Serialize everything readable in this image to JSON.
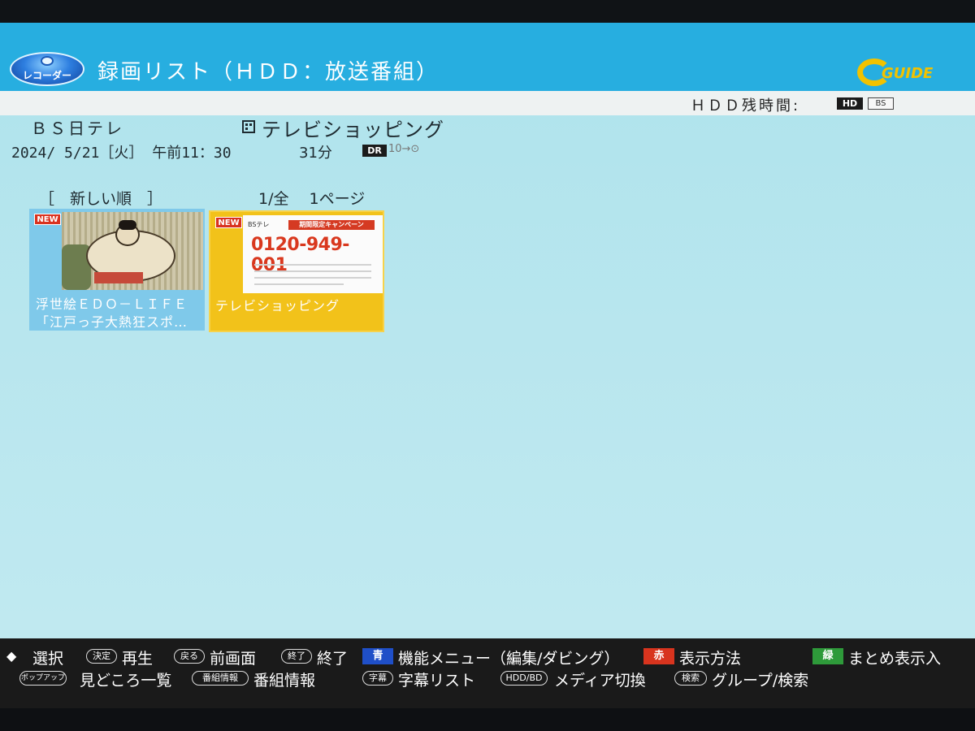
{
  "header": {
    "logo_text": "レコーダー",
    "title": "録画リスト（ＨＤＤ：放送番組）",
    "guide_logo": "GUIDE"
  },
  "hdd": {
    "label": "ＨＤＤ残時間:",
    "hd_badge": "HD",
    "bs_badge": "BS"
  },
  "program": {
    "channel": "ＢＳ日テレ",
    "title": "テレビショッピング",
    "datetime": "2024/ 5/21［火］ 午前11：30",
    "duration": "31分",
    "mode_badge": "DR",
    "mode_arrow": "10→⊙"
  },
  "list": {
    "sort": "［　新しい順　］",
    "page": "1/全　 1ページ",
    "items": [
      {
        "badge": "NEW",
        "line1": "浮世絵ＥＤＯ－ＬＩＦＥ",
        "line2": "「江戸っ子大熱狂スポ…"
      },
      {
        "badge": "NEW",
        "line1": "テレビショッピング",
        "thumb_logo": "BSテレ",
        "thumb_campaign": "期間限定キャンペーン",
        "thumb_phone": "0120-949-001"
      }
    ]
  },
  "help": {
    "dpad": "◆",
    "select": "選択",
    "kettei_key": "決定",
    "play": "再生",
    "modoru_key": "戻る",
    "prev": "前画面",
    "shuryo_key": "終了",
    "exit": "終了",
    "blue_key": "青",
    "func_menu": "機能メニュー（編集/ダビング）",
    "red_key": "赤",
    "display": "表示方法",
    "green_key": "緑",
    "group": "まとめ表示入",
    "popup_key": "ポップアップ",
    "highlights": "見どころ一覧",
    "proginfo_key": "番組情報",
    "proginfo": "番組情報",
    "jimaku_key": "字幕",
    "subtitle_list": "字幕リスト",
    "media_key": "HDD/BD",
    "media_switch": "メディア切換",
    "search_key": "検索",
    "group_search": "グループ/検索"
  },
  "colors": {
    "header": "#27aee0",
    "background": "#b8e6ee",
    "selected_tile": "#f2c21a",
    "new_badge": "#d9321f"
  }
}
